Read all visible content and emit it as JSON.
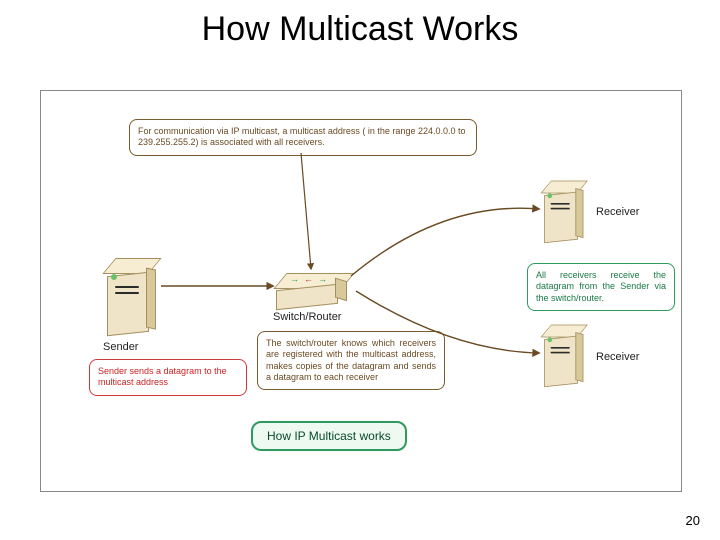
{
  "title": "How Multicast Works",
  "page_number": "20",
  "diagram": {
    "note_top": "For communication via IP multicast, a multicast address ( in the range 224.0.0.0 to 239.255.255.2) is associated with all receivers.",
    "note_sender": "Sender sends a datagram to the multicast address",
    "note_receivers": "All receivers receive the datagram from the Sender via the switch/router.",
    "note_switch": "The switch/router knows which receivers are registered with the multicast address, makes copies of the datagram and sends a datagram to each receiver",
    "caption_title": "How IP Multicast works",
    "label_sender": "Sender",
    "label_switch": "Switch/Router",
    "label_receiver_top": "Receiver",
    "label_receiver_bottom": "Receiver"
  }
}
